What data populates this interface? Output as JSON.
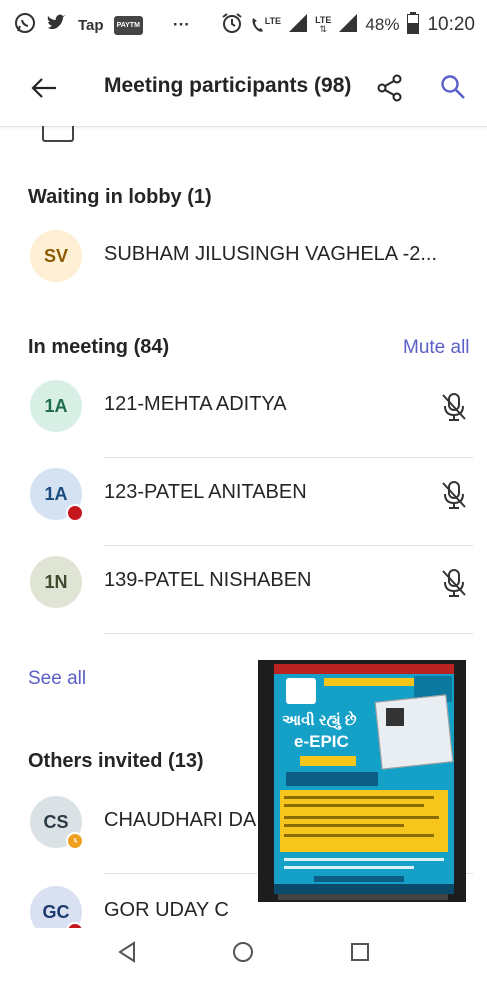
{
  "status_bar": {
    "carrier_label": "Tap",
    "app_label": "PAYTM",
    "more": "···",
    "lte1": "LTE",
    "lte2": "LTE",
    "battery": "48%",
    "time": "10:20"
  },
  "header": {
    "title": "Meeting participants (98)"
  },
  "lobby": {
    "title": "Waiting in lobby (1)",
    "participants": [
      {
        "initials": "SV",
        "name": "SUBHAM JILUSINGH VAGHELA -2...",
        "avatar_bg": "#fdf0d5",
        "avatar_fg": "#8a5a00"
      }
    ]
  },
  "in_meeting": {
    "title": "In meeting (84)",
    "mute_all_label": "Mute all",
    "participants": [
      {
        "initials": "1A",
        "name": "121-MEHTA ADITYA",
        "avatar_bg": "#d7efe4",
        "avatar_fg": "#1d6b4a"
      },
      {
        "initials": "1A",
        "name": "123-PATEL ANITABEN",
        "avatar_bg": "#d4e2f2",
        "avatar_fg": "#1b4c80",
        "status_color": "#c4161c"
      },
      {
        "initials": "1N",
        "name": "139-PATEL NISHABEN",
        "avatar_bg": "#dfe4d5",
        "avatar_fg": "#3f4a2d"
      }
    ],
    "see_all_label": "See all"
  },
  "others_invited": {
    "title": "Others invited (13)",
    "participants": [
      {
        "initials": "CS",
        "name": "CHAUDHARI DA",
        "avatar_bg": "#dbe2e6",
        "avatar_fg": "#2b3a44",
        "status_color": "#f0a020"
      },
      {
        "initials": "GC",
        "name": "GOR UDAY C",
        "avatar_bg": "#d9e0f0",
        "avatar_fg": "#1f3a70",
        "status_color": "#c4161c"
      }
    ]
  },
  "shared_content": {
    "headline1": "આવી રહ્યું છે",
    "headline2": "e-EPIC"
  },
  "colors": {
    "accent": "#5b5fc7"
  }
}
